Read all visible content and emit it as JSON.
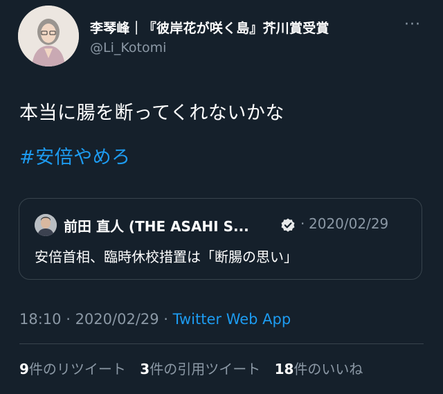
{
  "author": {
    "display_name": "李琴峰｜『彼岸花が咲く島』芥川賞受賞",
    "handle": "@Li_Kotomi"
  },
  "more_label": "···",
  "tweet": {
    "text": "本当に腸を断ってくれないかな",
    "hashtag": "#安倍やめろ"
  },
  "quote": {
    "name": "前田 直人 (THE ASAHI S...",
    "separator": "·",
    "date": "2020/02/29",
    "text": "安倍首相、臨時休校措置は「断腸の思い」"
  },
  "meta": {
    "time": "18:10",
    "separator1": " · ",
    "date": "2020/02/29",
    "separator2": " · ",
    "source": "Twitter Web App"
  },
  "stats": {
    "retweets_count": "9",
    "retweets_label": "件のリツイート",
    "quotes_count": "3",
    "quotes_label": "件の引用ツイート",
    "likes_count": "18",
    "likes_label": "件のいいね"
  },
  "colors": {
    "background": "#15202b",
    "accent": "#1d9bf0",
    "secondary_text": "#8b98a5",
    "border": "#38444d"
  }
}
